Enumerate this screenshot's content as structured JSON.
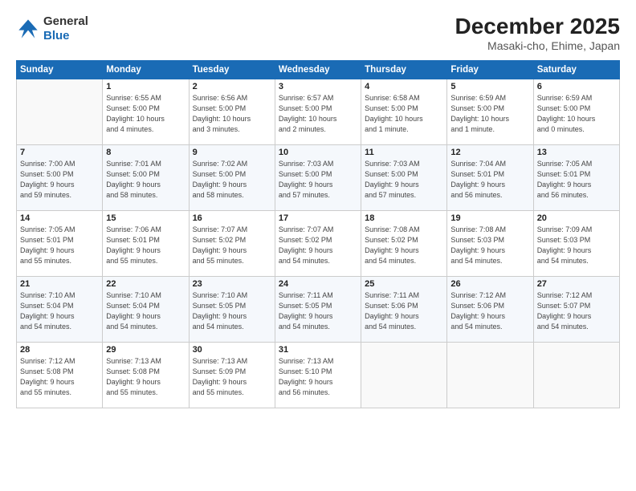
{
  "header": {
    "logo_line1": "General",
    "logo_line2": "Blue",
    "month": "December 2025",
    "location": "Masaki-cho, Ehime, Japan"
  },
  "weekdays": [
    "Sunday",
    "Monday",
    "Tuesday",
    "Wednesday",
    "Thursday",
    "Friday",
    "Saturday"
  ],
  "weeks": [
    [
      {
        "day": "",
        "info": ""
      },
      {
        "day": "1",
        "info": "Sunrise: 6:55 AM\nSunset: 5:00 PM\nDaylight: 10 hours\nand 4 minutes."
      },
      {
        "day": "2",
        "info": "Sunrise: 6:56 AM\nSunset: 5:00 PM\nDaylight: 10 hours\nand 3 minutes."
      },
      {
        "day": "3",
        "info": "Sunrise: 6:57 AM\nSunset: 5:00 PM\nDaylight: 10 hours\nand 2 minutes."
      },
      {
        "day": "4",
        "info": "Sunrise: 6:58 AM\nSunset: 5:00 PM\nDaylight: 10 hours\nand 1 minute."
      },
      {
        "day": "5",
        "info": "Sunrise: 6:59 AM\nSunset: 5:00 PM\nDaylight: 10 hours\nand 1 minute."
      },
      {
        "day": "6",
        "info": "Sunrise: 6:59 AM\nSunset: 5:00 PM\nDaylight: 10 hours\nand 0 minutes."
      }
    ],
    [
      {
        "day": "7",
        "info": "Sunrise: 7:00 AM\nSunset: 5:00 PM\nDaylight: 9 hours\nand 59 minutes."
      },
      {
        "day": "8",
        "info": "Sunrise: 7:01 AM\nSunset: 5:00 PM\nDaylight: 9 hours\nand 58 minutes."
      },
      {
        "day": "9",
        "info": "Sunrise: 7:02 AM\nSunset: 5:00 PM\nDaylight: 9 hours\nand 58 minutes."
      },
      {
        "day": "10",
        "info": "Sunrise: 7:03 AM\nSunset: 5:00 PM\nDaylight: 9 hours\nand 57 minutes."
      },
      {
        "day": "11",
        "info": "Sunrise: 7:03 AM\nSunset: 5:00 PM\nDaylight: 9 hours\nand 57 minutes."
      },
      {
        "day": "12",
        "info": "Sunrise: 7:04 AM\nSunset: 5:01 PM\nDaylight: 9 hours\nand 56 minutes."
      },
      {
        "day": "13",
        "info": "Sunrise: 7:05 AM\nSunset: 5:01 PM\nDaylight: 9 hours\nand 56 minutes."
      }
    ],
    [
      {
        "day": "14",
        "info": "Sunrise: 7:05 AM\nSunset: 5:01 PM\nDaylight: 9 hours\nand 55 minutes."
      },
      {
        "day": "15",
        "info": "Sunrise: 7:06 AM\nSunset: 5:01 PM\nDaylight: 9 hours\nand 55 minutes."
      },
      {
        "day": "16",
        "info": "Sunrise: 7:07 AM\nSunset: 5:02 PM\nDaylight: 9 hours\nand 55 minutes."
      },
      {
        "day": "17",
        "info": "Sunrise: 7:07 AM\nSunset: 5:02 PM\nDaylight: 9 hours\nand 54 minutes."
      },
      {
        "day": "18",
        "info": "Sunrise: 7:08 AM\nSunset: 5:02 PM\nDaylight: 9 hours\nand 54 minutes."
      },
      {
        "day": "19",
        "info": "Sunrise: 7:08 AM\nSunset: 5:03 PM\nDaylight: 9 hours\nand 54 minutes."
      },
      {
        "day": "20",
        "info": "Sunrise: 7:09 AM\nSunset: 5:03 PM\nDaylight: 9 hours\nand 54 minutes."
      }
    ],
    [
      {
        "day": "21",
        "info": "Sunrise: 7:10 AM\nSunset: 5:04 PM\nDaylight: 9 hours\nand 54 minutes."
      },
      {
        "day": "22",
        "info": "Sunrise: 7:10 AM\nSunset: 5:04 PM\nDaylight: 9 hours\nand 54 minutes."
      },
      {
        "day": "23",
        "info": "Sunrise: 7:10 AM\nSunset: 5:05 PM\nDaylight: 9 hours\nand 54 minutes."
      },
      {
        "day": "24",
        "info": "Sunrise: 7:11 AM\nSunset: 5:05 PM\nDaylight: 9 hours\nand 54 minutes."
      },
      {
        "day": "25",
        "info": "Sunrise: 7:11 AM\nSunset: 5:06 PM\nDaylight: 9 hours\nand 54 minutes."
      },
      {
        "day": "26",
        "info": "Sunrise: 7:12 AM\nSunset: 5:06 PM\nDaylight: 9 hours\nand 54 minutes."
      },
      {
        "day": "27",
        "info": "Sunrise: 7:12 AM\nSunset: 5:07 PM\nDaylight: 9 hours\nand 54 minutes."
      }
    ],
    [
      {
        "day": "28",
        "info": "Sunrise: 7:12 AM\nSunset: 5:08 PM\nDaylight: 9 hours\nand 55 minutes."
      },
      {
        "day": "29",
        "info": "Sunrise: 7:13 AM\nSunset: 5:08 PM\nDaylight: 9 hours\nand 55 minutes."
      },
      {
        "day": "30",
        "info": "Sunrise: 7:13 AM\nSunset: 5:09 PM\nDaylight: 9 hours\nand 55 minutes."
      },
      {
        "day": "31",
        "info": "Sunrise: 7:13 AM\nSunset: 5:10 PM\nDaylight: 9 hours\nand 56 minutes."
      },
      {
        "day": "",
        "info": ""
      },
      {
        "day": "",
        "info": ""
      },
      {
        "day": "",
        "info": ""
      }
    ]
  ]
}
